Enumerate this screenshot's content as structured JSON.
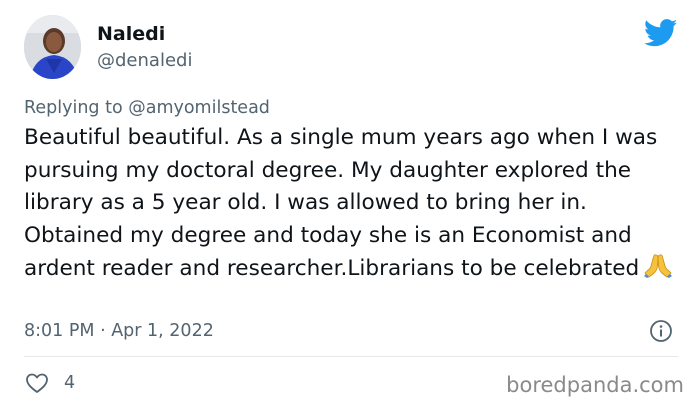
{
  "author": {
    "display_name": "Naledi",
    "handle": "@denaledi"
  },
  "reply": {
    "text": "Replying to @amyomilstead"
  },
  "tweet": {
    "text": "Beautiful beautiful. As a single mum years ago when I was pursuing my doctoral degree. My daughter explored the library as a 5 year old. I was allowed to bring her in. Obtained my degree and today she is an Economist and ardent reader and researcher.Librarians to be celebrated",
    "emoji": "folded-hands-emoji",
    "timestamp": "8:01 PM · Apr 1, 2022"
  },
  "engagement": {
    "likes": "4"
  },
  "watermark": "boredpanda.com",
  "colors": {
    "twitter_blue": "#1d9bf0",
    "secondary_text": "#536471",
    "primary_text": "#0f1419"
  },
  "icons": {
    "logo": "twitter-bird-icon",
    "info": "info-icon",
    "like": "heart-outline-icon"
  }
}
